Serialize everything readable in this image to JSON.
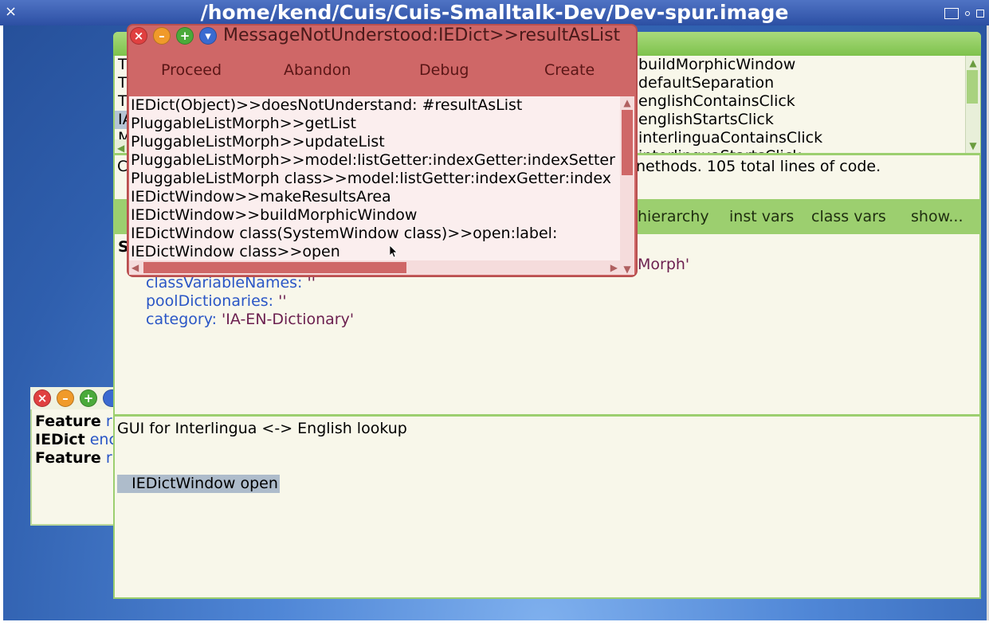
{
  "os_window": {
    "title": "/home/kend/Cuis/Cuis-Smalltalk-Dev/Dev-spur.image",
    "close_glyph": "×"
  },
  "feature_window": {
    "lines": [
      {
        "bold": "Feature",
        "rest": "r"
      },
      {
        "bold": "IEDict",
        "rest": "enc"
      },
      {
        "bold": "Feature",
        "rest": "r"
      }
    ]
  },
  "browser": {
    "left_list_partial": [
      "T",
      "T",
      "T",
      "IA",
      "M"
    ],
    "message_list": [
      "buildMorphicWindow",
      "defaultSeparation",
      "englishContainsClick",
      "englishStartsClick",
      "interlinguaContainsClick",
      "interlinguaStartsClick"
    ],
    "status_left": "C",
    "status": "nethods. 105 total lines of code.",
    "buttons": [
      "hierarchy",
      "inst vars",
      "class vars",
      "show..."
    ],
    "code_partial_left": "S",
    "code_partial_right": "Morph'",
    "code": [
      {
        "kw": "classVariableNames:",
        "val": "''"
      },
      {
        "kw": "poolDictionaries:",
        "val": "''"
      },
      {
        "kw": "category:",
        "val": "'IA-EN-Dictionary'"
      }
    ],
    "comment": "GUI for Interlingua <-> English lookup",
    "comment_selected": "   IEDictWindow open",
    "colors": {
      "accent": "#9ccf6f",
      "background": "#f8f7ea"
    }
  },
  "debugger": {
    "title": "MessageNotUnderstood:IEDict>>resultAsList",
    "window_buttons": {
      "close": "×",
      "minimize": "–",
      "expand": "+",
      "menu": "▾"
    },
    "buttons": [
      "Proceed",
      "Abandon",
      "Debug",
      "Create"
    ],
    "stack": [
      "IEDict(Object)>>doesNotUnderstand: #resultAsList",
      "PluggableListMorph>>getList",
      "PluggableListMorph>>updateList",
      "PluggableListMorph>>model:listGetter:indexGetter:indexSetter",
      "PluggableListMorph class>>model:listGetter:indexGetter:index",
      "IEDictWindow>>makeResultsArea",
      "IEDictWindow>>buildMorphicWindow",
      "IEDictWindow class(SystemWindow class)>>open:label:",
      "IEDictWindow class>>open"
    ],
    "colors": {
      "frame": "#cf6767",
      "list_bg": "#fbeeee"
    }
  }
}
